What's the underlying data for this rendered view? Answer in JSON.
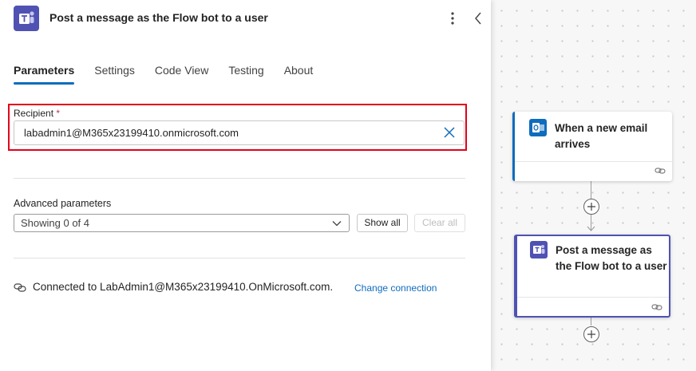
{
  "panel": {
    "title": "Post a message as the Flow bot to a user",
    "more_icon": "more-vertical-icon",
    "collapse_icon": "chevron-left-icon"
  },
  "tabs": [
    {
      "label": "Parameters",
      "active": true
    },
    {
      "label": "Settings",
      "active": false
    },
    {
      "label": "Code View",
      "active": false
    },
    {
      "label": "Testing",
      "active": false
    },
    {
      "label": "About",
      "active": false
    }
  ],
  "recipient": {
    "label": "Recipient",
    "required_marker": "*",
    "value": "labadmin1@M365x23199410.onmicrosoft.com"
  },
  "advanced": {
    "label": "Advanced parameters",
    "select_value": "Showing 0 of 4",
    "show_all": "Show all",
    "clear_all": "Clear all"
  },
  "connection": {
    "text": "Connected to LabAdmin1@M365x23199410.OnMicrosoft.com.",
    "change_link": "Change connection"
  },
  "flow": {
    "trigger": {
      "title": "When a new email arrives",
      "icon": "outlook-icon"
    },
    "action": {
      "title": "Post a message as the Flow bot to a user",
      "icon": "teams-icon"
    }
  },
  "colors": {
    "accent": "#0f6cbd",
    "teams": "#4f52b2",
    "highlight": "#e3001b"
  }
}
